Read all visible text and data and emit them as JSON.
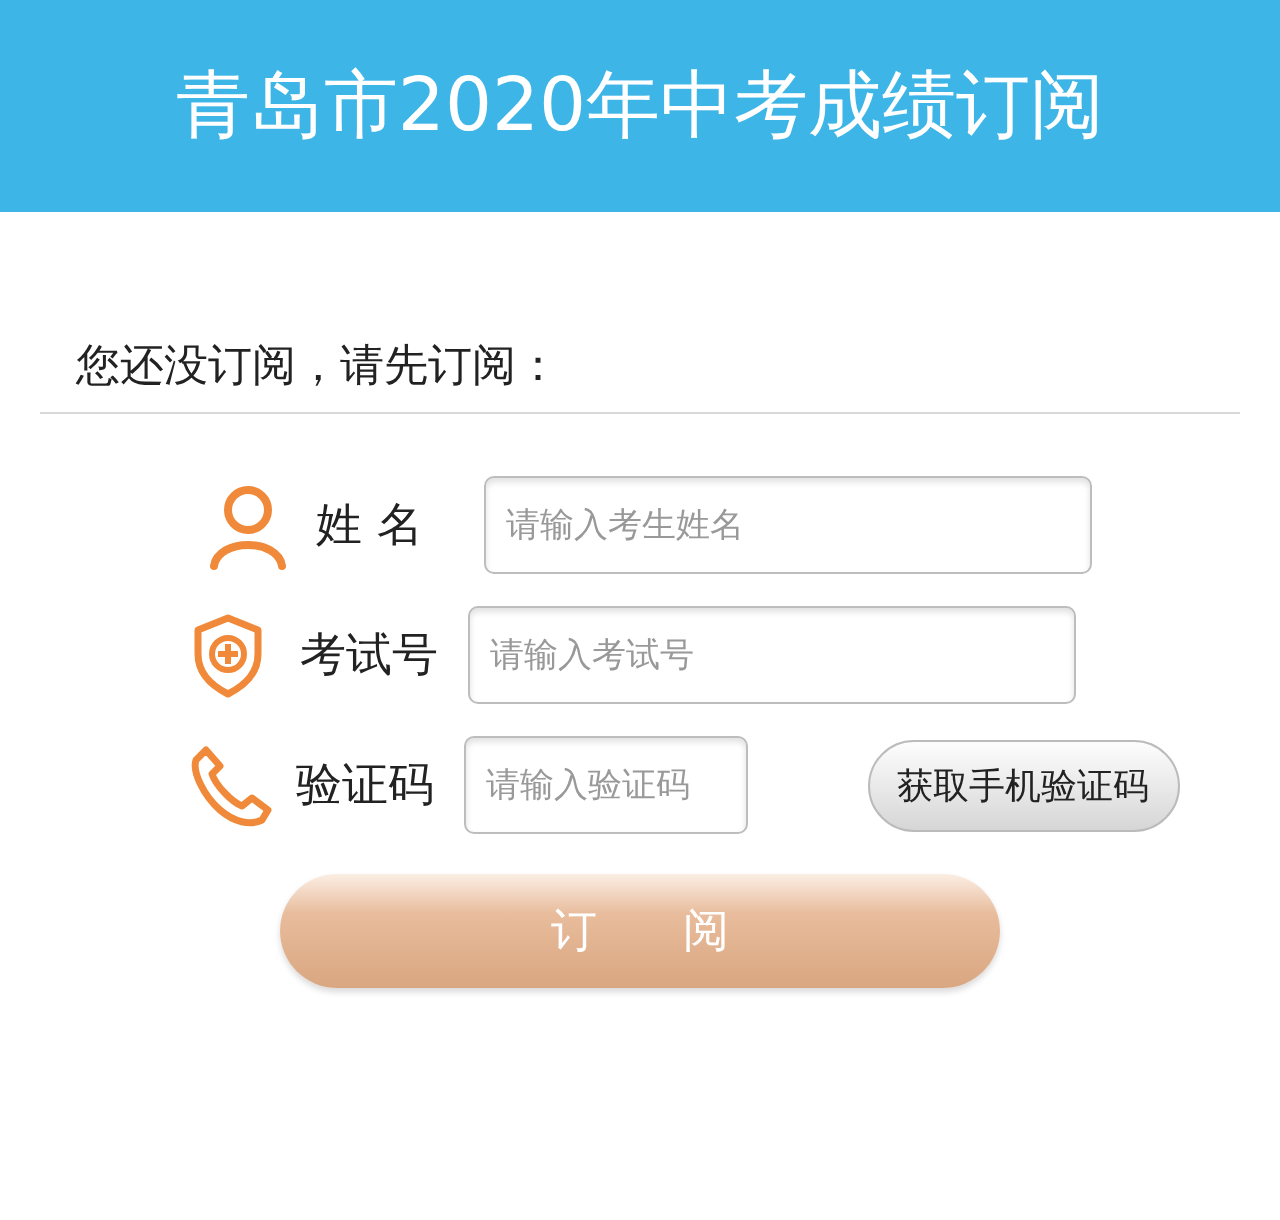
{
  "header": {
    "title": "青岛市2020年中考成绩订阅"
  },
  "prompt": "您还没订阅，请先订阅：",
  "fields": [
    {
      "kind": "person",
      "label": "姓 名",
      "placeholder": "请输入考生姓名"
    },
    {
      "kind": "shield",
      "label": "考试号",
      "placeholder": "请输入考试号"
    },
    {
      "kind": "phone",
      "label": "验证码",
      "placeholder": "请输入验证码",
      "button": "获取手机验证码"
    }
  ],
  "submit": "订 阅"
}
